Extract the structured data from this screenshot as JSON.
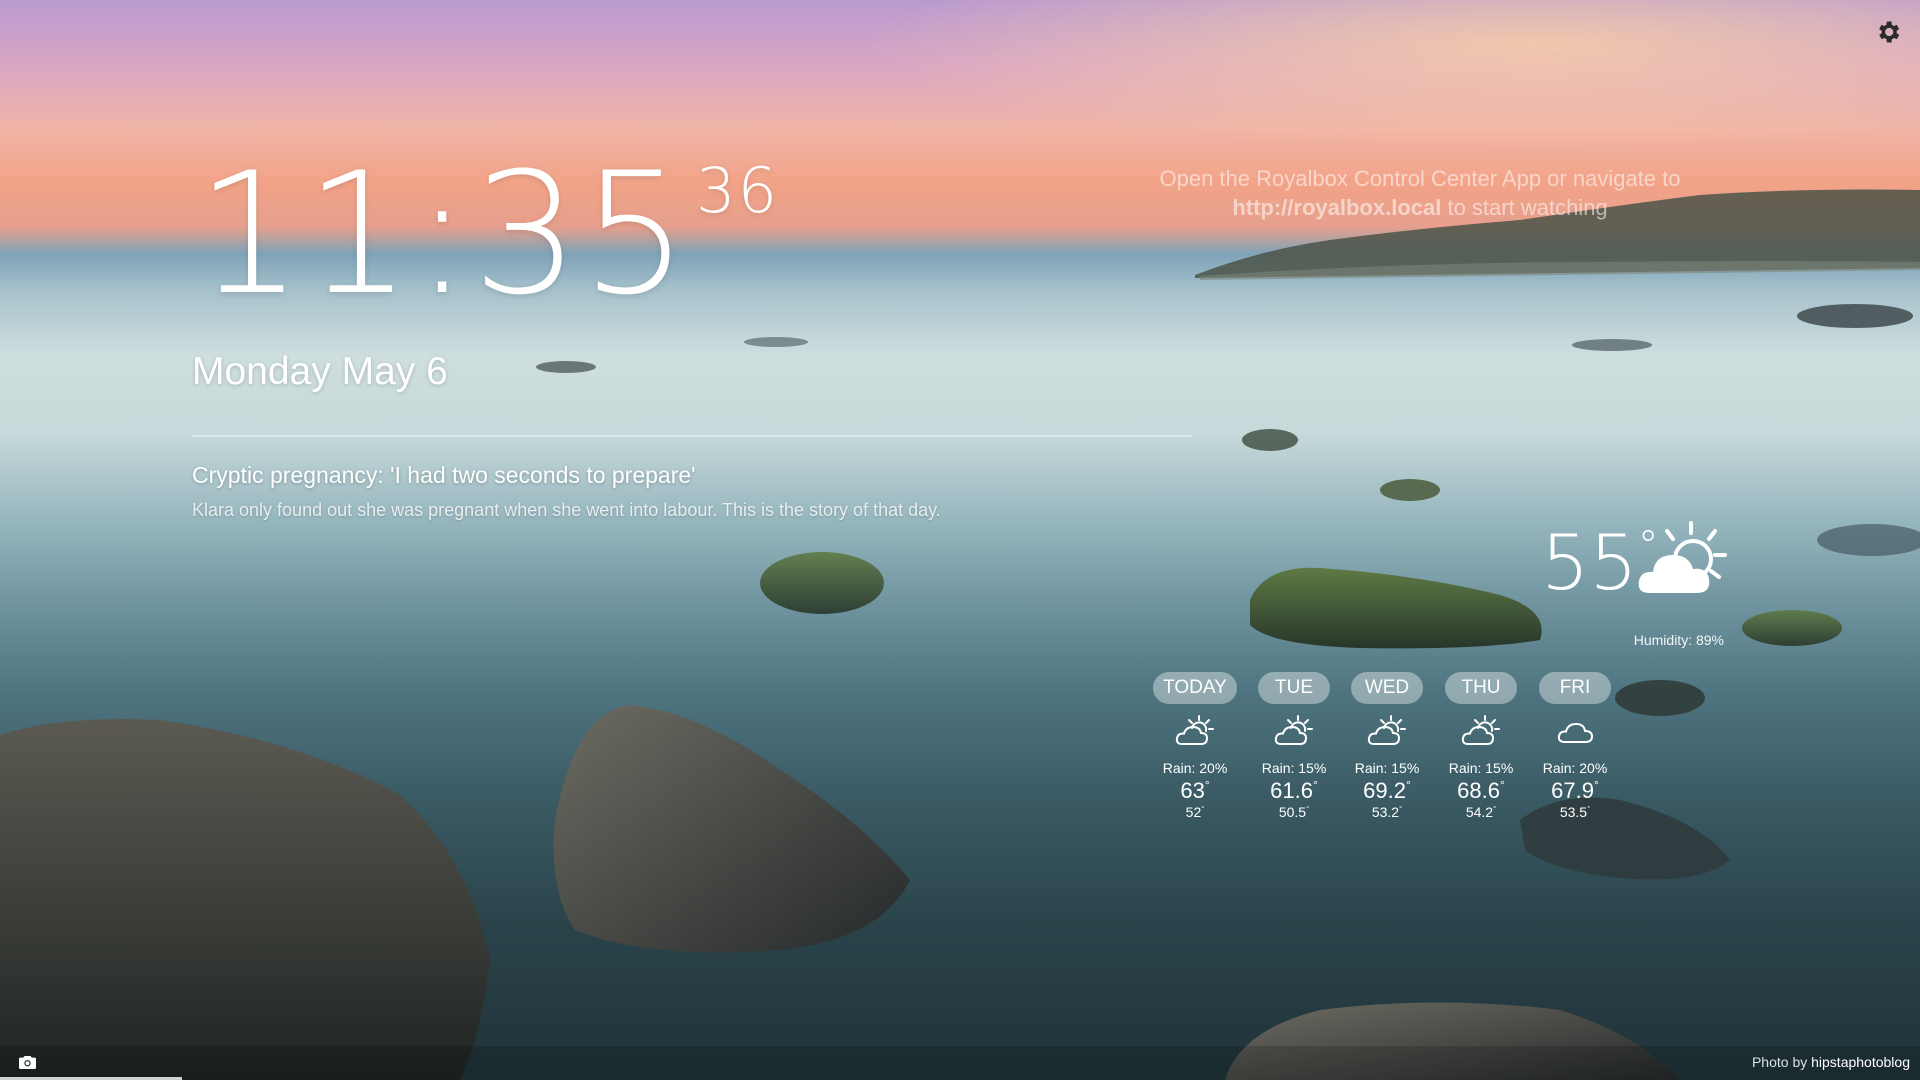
{
  "clock": {
    "time": "11:35",
    "seconds": "36"
  },
  "date": "Monday May 6",
  "news": {
    "headline": "Cryptic pregnancy: 'I had two seconds to prepare'",
    "summary": "Klara only found out she was pregnant when she went into labour. This is the story of that day."
  },
  "connect_message": {
    "line1": "Open the Royalbox Control Center App or navigate to",
    "url": "http://royalbox.local",
    "line2_rest": " to start watching"
  },
  "weather": {
    "current_temp": "55",
    "degree_symbol": "°",
    "current_icon": "partly-cloudy-day-icon",
    "humidity": "Humidity: 89%",
    "forecast": [
      {
        "day": "TODAY",
        "icon": "partly-cloudy-day-icon",
        "rain": "Rain: 20%",
        "high": "63",
        "low": "52"
      },
      {
        "day": "TUE",
        "icon": "partly-cloudy-day-icon",
        "rain": "Rain: 15%",
        "high": "61.6",
        "low": "50.5"
      },
      {
        "day": "WED",
        "icon": "partly-cloudy-day-icon",
        "rain": "Rain: 15%",
        "high": "69.2",
        "low": "53.2"
      },
      {
        "day": "THU",
        "icon": "partly-cloudy-day-icon",
        "rain": "Rain: 15%",
        "high": "68.6",
        "low": "54.2"
      },
      {
        "day": "FRI",
        "icon": "cloudy-icon",
        "rain": "Rain: 20%",
        "high": "67.9",
        "low": "53.5"
      }
    ]
  },
  "footer": {
    "credit_prefix": "Photo by ",
    "credit_author": "hipstaphotoblog",
    "slideshow_progress": 0.095
  },
  "icons": {
    "settings": "gear-icon",
    "camera": "camera-icon"
  }
}
